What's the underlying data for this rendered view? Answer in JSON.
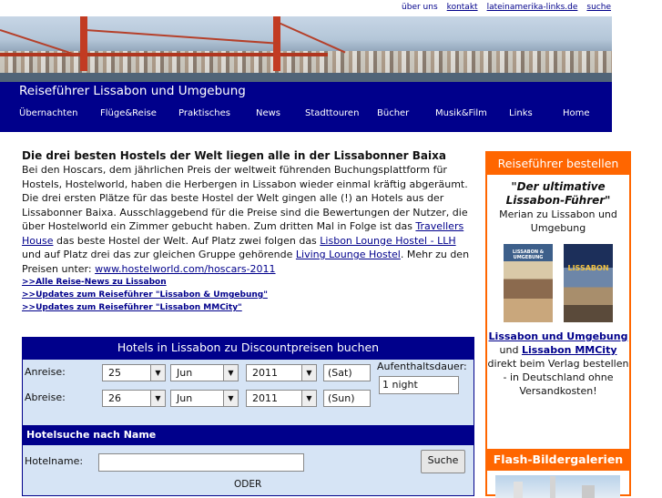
{
  "top_links": [
    "über uns",
    "kontakt",
    "lateinamerika-links.de",
    "suche"
  ],
  "site_title": "Reiseführer Lissabon und Umgebung",
  "menu": [
    "Übernachten",
    "Flüge&Reise",
    "Praktisches",
    "News",
    "Stadttouren",
    "Bücher",
    "Musik&Film",
    "Links",
    "Home"
  ],
  "article": {
    "headline": "Die drei besten Hostels der Welt liegen alle in der Lissabonner Baixa",
    "body_1": "Bei den Hoscars, dem jährlichen Preis der weltweit führenden Buchungsplattform für Hostels, Hostelworld, haben die Herbergen in Lissabon wieder einmal kräftig abgeräumt. Die drei ersten Plätze für das beste Hostel der Welt gingen alle (!) an Hotels aus der Lissabonner Baixa. Ausschlaggebend für die Preise sind die Bewertungen der Nutzer, die über Hostelworld ein Zimmer gebucht haben. Zum dritten Mal in Folge ist das ",
    "link_1": "Travellers House",
    "body_2": " das beste Hostel der Welt. Auf Platz zwei folgen das ",
    "link_2": "Lisbon Lounge Hostel - LLH",
    "body_3": " und auf Platz drei das zur gleichen Gruppe gehörende ",
    "link_3": "Living Lounge Hostel",
    "body_4": ". Mehr zu den Preisen unter: ",
    "link_4": "www.hostelworld.com/hoscars-2011",
    "links": [
      ">>Alle Reise-News zu Lissabon",
      ">>Updates zum Reiseführer \"Lissabon & Umgebung\"",
      ">>Updates zum Reiseführer \"Lissabon MMCity\""
    ]
  },
  "booking": {
    "header": "Hotels in Lissabon zu Discountpreisen buchen",
    "arrival_label": "Anreise:",
    "departure_label": "Abreise:",
    "arrival": {
      "day": "25",
      "month": "Jun",
      "year": "2011",
      "weekday": "(Sat)"
    },
    "departure": {
      "day": "26",
      "month": "Jun",
      "year": "2011",
      "weekday": "(Sun)"
    },
    "stay_label": "Aufenthaltsdauer:",
    "stay_value": "1 night",
    "name_search_header": "Hotelsuche nach Name",
    "hotelname_label": "Hotelname:",
    "search_button": "Suche",
    "or_label": "ODER"
  },
  "sidebar": {
    "header": "Reiseführer bestellen",
    "quote": "\"Der ultimative Lissabon-Führer\"",
    "source": "Merian zu Lissabon und Umgebung",
    "book1_title": "LISSABON & UMGEBUNG",
    "book2_title": "LISSABON",
    "link_1": "Lissabon und Umgebung",
    "and": "und",
    "link_2": "Lissabon MMCity",
    "order_text": "direkt beim Verlag bestellen - in Deutschland ohne Versandkosten!",
    "flash_header": "Flash-Bildergalerien"
  },
  "colors": {
    "nav": "#00008b",
    "accent": "#ff6600",
    "form_bg": "#d6e4f5"
  }
}
